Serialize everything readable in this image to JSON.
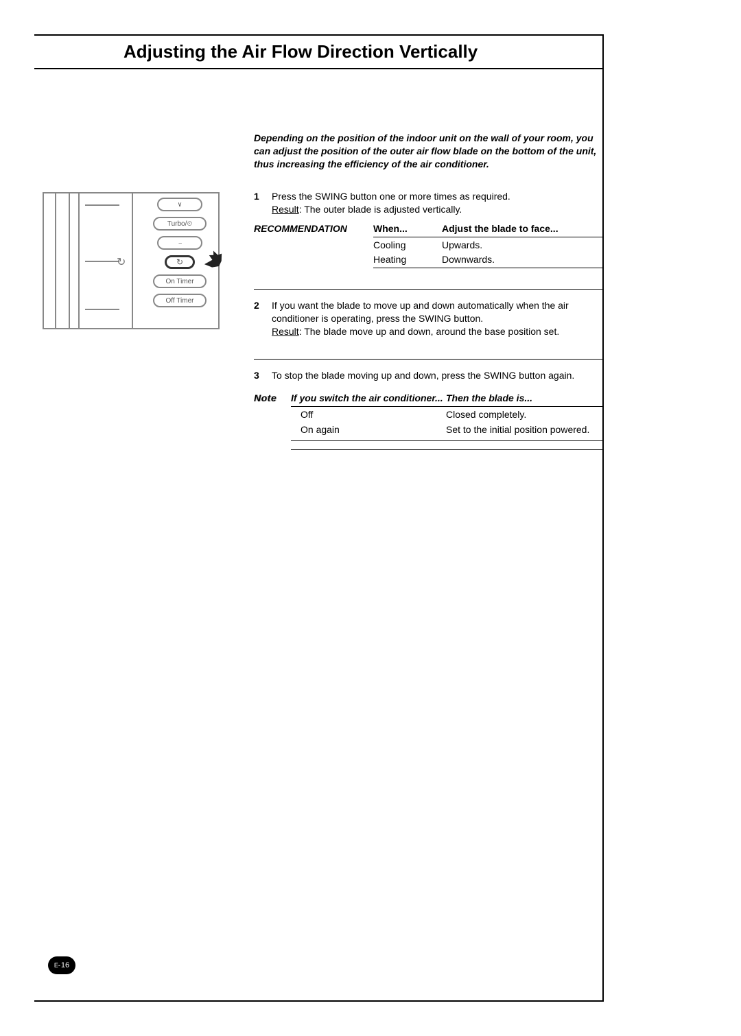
{
  "title": "Adjusting the Air Flow Direction Vertically",
  "remote": {
    "down_arrow": "∨",
    "turbo": "Turbo/",
    "dots": "",
    "on_timer": "On Timer",
    "off_timer": "Off Timer"
  },
  "intro": "Depending on the position of the indoor unit on the wall of your room, you can adjust the position of the outer air flow blade on the bottom of the unit, thus increasing the efficiency of the air conditioner.",
  "step1": {
    "num": "1",
    "text": "Press the SWING button one or more times as required.",
    "result_label": "Result",
    "result_text": ":   The outer blade is adjusted vertically."
  },
  "recommendation": {
    "label": "RECOMMENDATION",
    "head_when": "When...",
    "head_adjust": "Adjust the blade to face...",
    "rows": [
      {
        "when": "Cooling",
        "adjust": "Upwards."
      },
      {
        "when": "Heating",
        "adjust": "Downwards."
      }
    ]
  },
  "step2": {
    "num": "2",
    "text": "If you want the blade to move up and down automatically when the air conditioner is operating, press the SWING button.",
    "result_label": "Result",
    "result_text": ":   The blade move up and down, around the base position set."
  },
  "step3": {
    "num": "3",
    "text": "To stop the blade moving up and down, press the SWING button again."
  },
  "note": {
    "label": "Note",
    "head_if": "If you switch the air conditioner...",
    "head_then": "Then the blade is...",
    "rows": [
      {
        "if": "Off",
        "then": "Closed completely."
      },
      {
        "if": "On again",
        "then": "Set to the initial position powered."
      }
    ]
  },
  "page_prefix": "E-",
  "page_number": "16"
}
